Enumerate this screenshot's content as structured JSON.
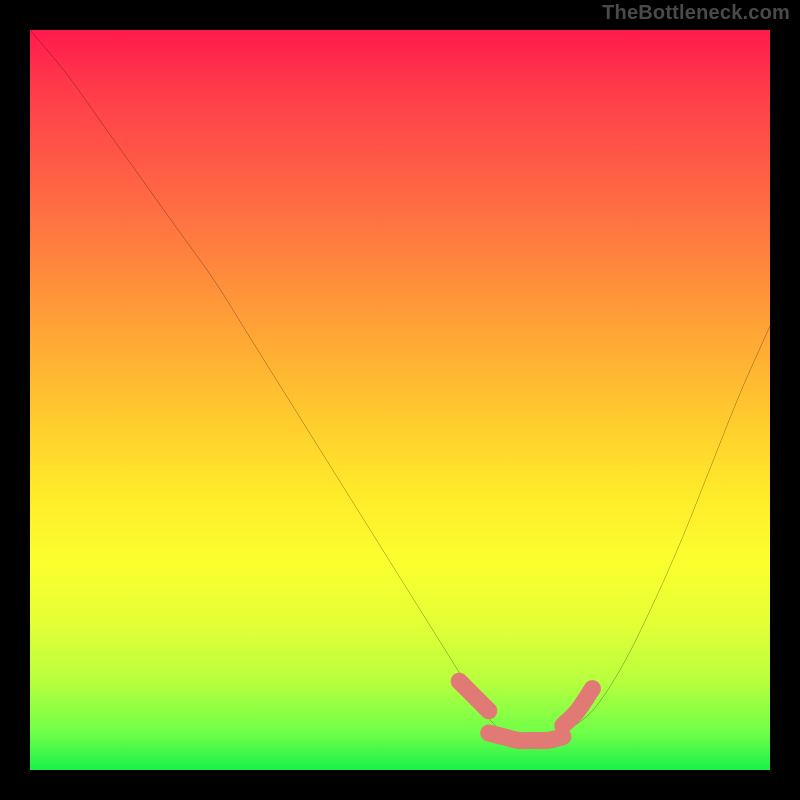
{
  "watermark": "TheBottleneck.com",
  "chart_data": {
    "type": "line",
    "title": "",
    "xlabel": "",
    "ylabel": "",
    "xlim": [
      0,
      100
    ],
    "ylim": [
      0,
      100
    ],
    "series": [
      {
        "name": "curve",
        "x": [
          0,
          5,
          10,
          15,
          20,
          25,
          30,
          35,
          40,
          45,
          50,
          55,
          60,
          62,
          64,
          66,
          68,
          70,
          72,
          76,
          80,
          84,
          88,
          92,
          96,
          100
        ],
        "values": [
          100,
          94,
          87,
          80,
          73,
          66,
          58,
          50,
          42,
          34,
          26,
          18,
          10,
          7,
          5,
          4,
          4,
          4,
          5,
          8,
          14,
          22,
          31,
          41,
          51,
          60
        ]
      }
    ],
    "overlay": {
      "name": "highlight-band",
      "color": "#e17974",
      "segments": [
        {
          "x": [
            58,
            60,
            62
          ],
          "values": [
            12,
            10,
            8
          ]
        },
        {
          "x": [
            62,
            64,
            66,
            68,
            70,
            72
          ],
          "values": [
            5,
            4.5,
            4,
            4,
            4,
            4.5
          ]
        },
        {
          "x": [
            72,
            74,
            76
          ],
          "values": [
            6,
            8,
            11
          ]
        }
      ]
    },
    "background": {
      "type": "vertical-gradient",
      "stops": [
        {
          "pos": 0,
          "color": "#ff1a4d"
        },
        {
          "pos": 18,
          "color": "#ff5a46"
        },
        {
          "pos": 40,
          "color": "#ffa236"
        },
        {
          "pos": 62,
          "color": "#ffe92a"
        },
        {
          "pos": 88,
          "color": "#b8ff3e"
        },
        {
          "pos": 100,
          "color": "#19f24a"
        }
      ]
    }
  }
}
